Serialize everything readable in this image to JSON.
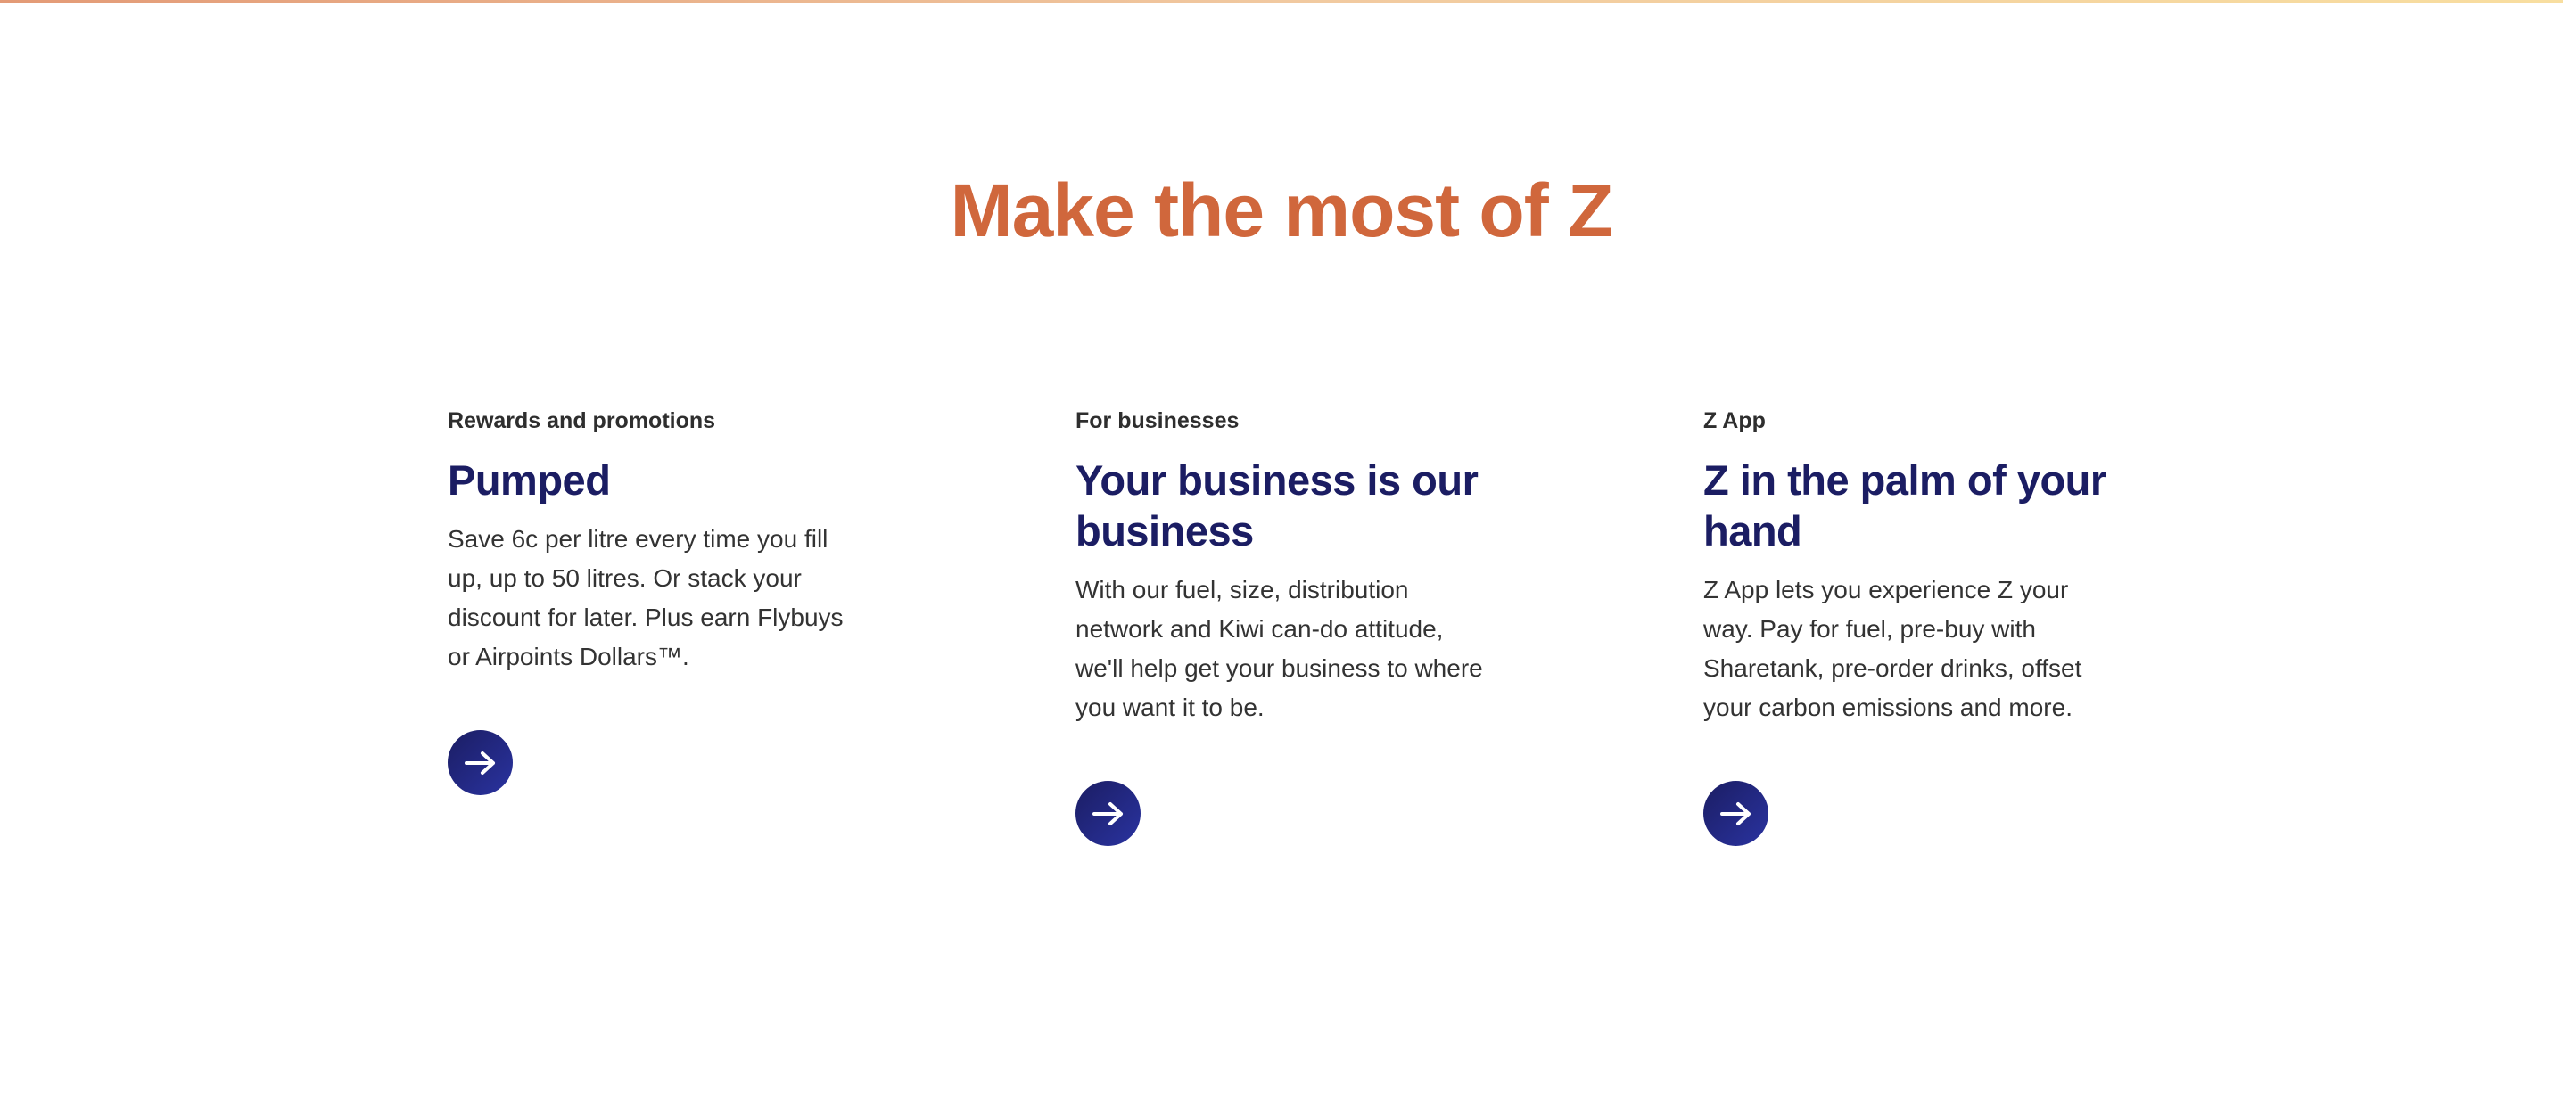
{
  "title": "Make the most of Z",
  "colors": {
    "accent": "#d0673c",
    "navy": "#1b1d63"
  },
  "cards": [
    {
      "label": "Rewards and promotions",
      "heading": "Pumped",
      "body": "Save 6c per litre every time you fill up, up to 50 litres. Or stack your discount for later. Plus earn Flybuys or Airpoints Dollars™.",
      "icon": "arrow-right-icon"
    },
    {
      "label": "For businesses",
      "heading": "Your business is our business",
      "body": "With our fuel, size, distribution network and Kiwi can-do attitude, we'll help get your business to where you want it to be.",
      "icon": "arrow-right-icon"
    },
    {
      "label": "Z App",
      "heading": "Z in the palm of your hand",
      "body": "Z App lets you experience Z your way. Pay for fuel, pre-buy with Sharetank, pre-order drinks, offset your carbon emissions and more.",
      "icon": "arrow-right-icon"
    }
  ]
}
